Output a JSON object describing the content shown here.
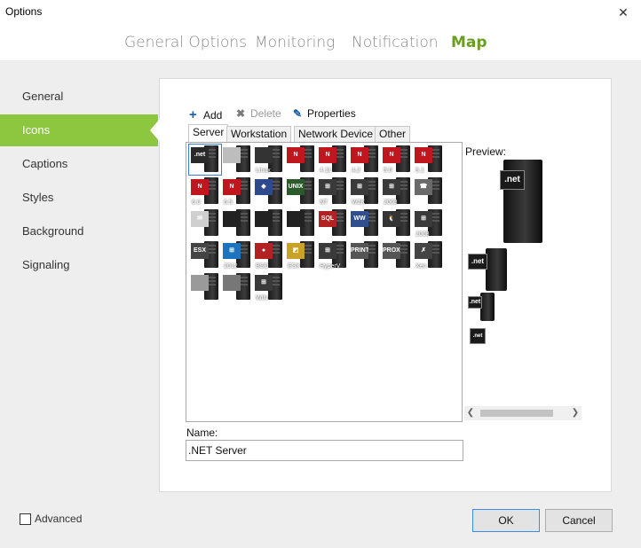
{
  "window": {
    "title": "Options",
    "close_glyph": "✕"
  },
  "tabs": [
    {
      "label": "General Options",
      "active": false
    },
    {
      "label": "Monitoring",
      "active": false
    },
    {
      "label": "Notification",
      "active": false
    },
    {
      "label": "Map",
      "active": true
    }
  ],
  "sidebar": {
    "items": [
      {
        "label": "General",
        "active": false
      },
      {
        "label": "Icons",
        "active": true
      },
      {
        "label": "Captions",
        "active": false
      },
      {
        "label": "Styles",
        "active": false
      },
      {
        "label": "Background",
        "active": false
      },
      {
        "label": "Signaling",
        "active": false
      }
    ]
  },
  "toolbar": {
    "add_label": "Add",
    "delete_label": "Delete",
    "properties_label": "Properties"
  },
  "icon_tabs": [
    {
      "label": "Server",
      "active": true
    },
    {
      "label": "Workstation",
      "active": false
    },
    {
      "label": "Network Device",
      "active": false
    },
    {
      "label": "Other",
      "active": false
    }
  ],
  "icons": [
    {
      "name": ".NET",
      "caption": "",
      "badge": ".net",
      "color": "#2a2a2a"
    },
    {
      "name": "generic-light",
      "caption": "",
      "badge": "",
      "color": "#bdbdbd"
    },
    {
      "name": "Linux",
      "caption": "Linux",
      "badge": "",
      "color": "#333333"
    },
    {
      "name": "Novell",
      "caption": "",
      "badge": "N",
      "color": "#c0161d"
    },
    {
      "name": "Novell 4.11",
      "caption": "4.11",
      "badge": "N",
      "color": "#c0161d"
    },
    {
      "name": "Novell 4.2",
      "caption": "4.2",
      "badge": "N",
      "color": "#c0161d"
    },
    {
      "name": "Novell 5.0",
      "caption": "5.0",
      "badge": "N",
      "color": "#c0161d"
    },
    {
      "name": "Novell 5.1",
      "caption": "5.1",
      "badge": "N",
      "color": "#c0161d"
    },
    {
      "name": "Novell 6.0",
      "caption": "6.0",
      "badge": "N",
      "color": "#c0161d"
    },
    {
      "name": "Novell 6.5",
      "caption": "6.5",
      "badge": "N",
      "color": "#c0161d"
    },
    {
      "name": "Sun",
      "caption": "",
      "badge": "◆",
      "color": "#2c4a8c"
    },
    {
      "name": "Unix",
      "caption": "",
      "badge": "UNIX",
      "color": "#2b5a2b"
    },
    {
      "name": "Windows NT",
      "caption": "NT",
      "badge": "⊞",
      "color": "#3a3a3a"
    },
    {
      "name": "Windows 2000",
      "caption": "W2K",
      "badge": "⊞",
      "color": "#3a3a3a"
    },
    {
      "name": "Windows 2003",
      "caption": "2003",
      "badge": "⊞",
      "color": "#3a3a3a"
    },
    {
      "name": "Fax",
      "caption": "",
      "badge": "☎",
      "color": "#6a6a6a"
    },
    {
      "name": "Mail",
      "caption": "",
      "badge": "✉",
      "color": "#cfcfcf"
    },
    {
      "name": "generic-dark",
      "caption": "",
      "badge": "",
      "color": "#222222"
    },
    {
      "name": "generic-user",
      "caption": "",
      "badge": "",
      "color": "#222222"
    },
    {
      "name": "generic-plain",
      "caption": "",
      "badge": "",
      "color": "#222222"
    },
    {
      "name": "SQL",
      "caption": "",
      "badge": "SQL",
      "color": "#b22222"
    },
    {
      "name": "WWW",
      "caption": "",
      "badge": "WW",
      "color": "#2f4f8f"
    },
    {
      "name": "Linux web",
      "caption": "",
      "badge": "🐧",
      "color": "#333333"
    },
    {
      "name": "Windows 2008",
      "caption": "2008",
      "badge": "⊞",
      "color": "#3a3a3a"
    },
    {
      "name": "ESX",
      "caption": "",
      "badge": "ESX",
      "color": "#444444"
    },
    {
      "name": "Windows 2012",
      "caption": "2012",
      "badge": "⊞",
      "color": "#1e73be"
    },
    {
      "name": "BSD",
      "caption": "BSD",
      "badge": "●",
      "color": "#b22222"
    },
    {
      "name": "ESX alt",
      "caption": "ESX",
      "badge": "◩",
      "color": "#c9a227"
    },
    {
      "name": "Hyper-V",
      "caption": "HyperV",
      "badge": "⊞",
      "color": "#3a3a3a"
    },
    {
      "name": "Print Server",
      "caption": "",
      "badge": "PRINT",
      "color": "#555555"
    },
    {
      "name": "Proxy",
      "caption": "",
      "badge": "PROXY",
      "color": "#555555"
    },
    {
      "name": "Xen",
      "caption": "Xen",
      "badge": "✗",
      "color": "#444444"
    },
    {
      "name": "Rack",
      "caption": "",
      "badge": "",
      "color": "#9a9a9a"
    },
    {
      "name": "SMTP",
      "caption": "",
      "badge": "",
      "color": "#777777"
    },
    {
      "name": "WIN",
      "caption": "WIN",
      "badge": "⊞",
      "color": "#3a3a3a"
    }
  ],
  "preview": {
    "label": "Preview:",
    "badge": ".net"
  },
  "name_field": {
    "label": "Name:",
    "value": ".NET Server"
  },
  "advanced": {
    "label": "Advanced",
    "checked": false
  },
  "buttons": {
    "ok": "OK",
    "cancel": "Cancel"
  },
  "colors": {
    "accent": "#8dc63f",
    "active_tab": "#6a9e21",
    "panel_bg": "#eeeeee"
  }
}
